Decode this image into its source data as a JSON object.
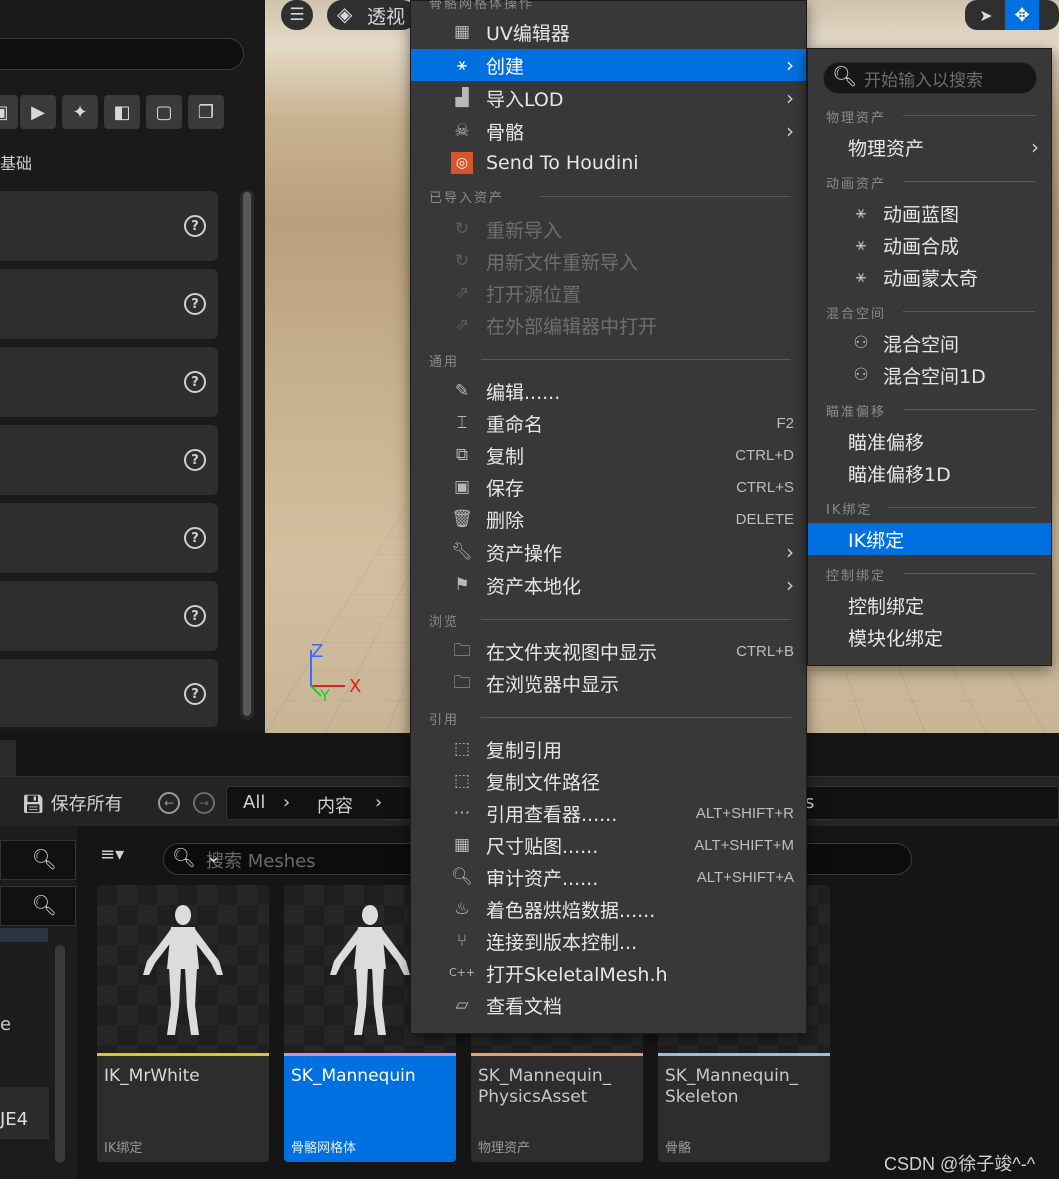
{
  "left_panel": {
    "category_label": "基础",
    "help_glyph": "?",
    "toolbar_icons": [
      "cube-icon",
      "play-frame-icon",
      "sparkle-icon",
      "shapes-icon",
      "frame-icon",
      "stack-icon"
    ]
  },
  "viewport": {
    "view_mode": "透视",
    "axis_labels": {
      "z": "Z",
      "y": "Y",
      "x": "X"
    }
  },
  "content_browser": {
    "save_all": "保存所有",
    "breadcrumb": [
      "All",
      "内容"
    ],
    "breadcrumb_tail": "s",
    "search_placeholder": "搜索 Meshes",
    "source_fragments": [
      "e",
      "JE4"
    ],
    "assets": [
      {
        "name": "IK_MrWhite",
        "type": "IK绑定",
        "color": "#e5c12a",
        "selected": false
      },
      {
        "name": "SK_Mannequin",
        "type": "骨骼网格体",
        "color": "#d08ed8",
        "selected": true
      },
      {
        "name": "SK_Mannequin_\nPhysicsAsset",
        "type": "物理资产",
        "color": "#e8a566",
        "selected": false
      },
      {
        "name": "SK_Mannequin_\nSkeleton",
        "type": "骨骼",
        "color": "#8ec4e6",
        "selected": false
      }
    ]
  },
  "context_menu": {
    "header_partial": "骨骼网格体操作",
    "items_top": [
      {
        "label": "UV编辑器",
        "icon": "grid-icon",
        "arrow": false
      },
      {
        "label": "创建",
        "icon": "create-icon",
        "arrow": true,
        "highlight": true
      },
      {
        "label": "导入LOD",
        "icon": "lod-icon",
        "arrow": true
      },
      {
        "label": "骨骼",
        "icon": "skull-icon",
        "arrow": true
      },
      {
        "label": "Send To Houdini",
        "icon": "houdini-icon",
        "arrow": false
      }
    ],
    "section_imported": "已导入资产",
    "items_imported": [
      {
        "label": "重新导入",
        "icon": "reimport-icon"
      },
      {
        "label": "用新文件重新导入",
        "icon": "reimport-file-icon"
      },
      {
        "label": "打开源位置",
        "icon": "open-source-icon"
      },
      {
        "label": "在外部编辑器中打开",
        "icon": "external-editor-icon"
      }
    ],
    "section_common": "通用",
    "items_common": [
      {
        "label": "编辑......",
        "icon": "pencil-icon",
        "shortcut": ""
      },
      {
        "label": "重命名",
        "icon": "rename-icon",
        "shortcut": "F2"
      },
      {
        "label": "复制",
        "icon": "duplicate-icon",
        "shortcut": "CTRL+D"
      },
      {
        "label": "保存",
        "icon": "save-icon",
        "shortcut": "CTRL+S"
      },
      {
        "label": "删除",
        "icon": "trash-icon",
        "shortcut": "DELETE"
      },
      {
        "label": "资产操作",
        "icon": "wrench-icon",
        "arrow": true
      },
      {
        "label": "资产本地化",
        "icon": "flag-icon",
        "arrow": true
      }
    ],
    "section_browse": "浏览",
    "items_browse": [
      {
        "label": "在文件夹视图中显示",
        "icon": "folder-search-icon",
        "shortcut": "CTRL+B"
      },
      {
        "label": "在浏览器中显示",
        "icon": "browser-search-icon",
        "shortcut": ""
      }
    ],
    "section_reference": "引用",
    "items_reference": [
      {
        "label": "复制引用",
        "icon": "copy-ref-icon",
        "shortcut": ""
      },
      {
        "label": "复制文件路径",
        "icon": "copy-path-icon",
        "shortcut": ""
      },
      {
        "label": "引用查看器......",
        "icon": "ref-viewer-icon",
        "shortcut": "ALT+SHIFT+R"
      },
      {
        "label": "尺寸贴图......",
        "icon": "size-map-icon",
        "shortcut": "ALT+SHIFT+M"
      },
      {
        "label": "审计资产......",
        "icon": "audit-icon",
        "shortcut": "ALT+SHIFT+A"
      },
      {
        "label": "着色器烘焙数据......",
        "icon": "shader-icon",
        "shortcut": ""
      },
      {
        "label": "连接到版本控制...",
        "icon": "branch-icon",
        "shortcut": ""
      },
      {
        "label": "打开SkeletalMesh.h",
        "icon": "cpp-icon",
        "shortcut": ""
      },
      {
        "label": "查看文档",
        "icon": "docs-icon",
        "shortcut": ""
      }
    ]
  },
  "submenu": {
    "search_placeholder": "开始输入以搜索",
    "sections": [
      {
        "title": "物理资产",
        "items": [
          {
            "label": "物理资产",
            "arrow": true,
            "icon": ""
          }
        ]
      },
      {
        "title": "动画资产",
        "items": [
          {
            "label": "动画蓝图",
            "icon": "anim-bp-icon"
          },
          {
            "label": "动画合成",
            "icon": "anim-montage-icon"
          },
          {
            "label": "动画蒙太奇",
            "icon": "anim-seq-icon"
          }
        ]
      },
      {
        "title": "混合空间",
        "items": [
          {
            "label": "混合空间",
            "icon": "blendspace-icon"
          },
          {
            "label": "混合空间1D",
            "icon": "blendspace1d-icon"
          }
        ]
      },
      {
        "title": "瞄准偏移",
        "items": [
          {
            "label": "瞄准偏移",
            "icon": ""
          },
          {
            "label": "瞄准偏移1D",
            "icon": ""
          }
        ]
      },
      {
        "title": "IK绑定",
        "items": [
          {
            "label": "IK绑定",
            "icon": "",
            "highlight": true
          }
        ]
      },
      {
        "title": "控制绑定",
        "items": [
          {
            "label": "控制绑定",
            "icon": ""
          },
          {
            "label": "模块化绑定",
            "icon": ""
          }
        ]
      }
    ]
  },
  "watermark": "CSDN @徐子竣^-^",
  "colors": {
    "accent": "#0070e0",
    "menu_bg": "#383838",
    "panel_bg": "#2e2e2e"
  }
}
